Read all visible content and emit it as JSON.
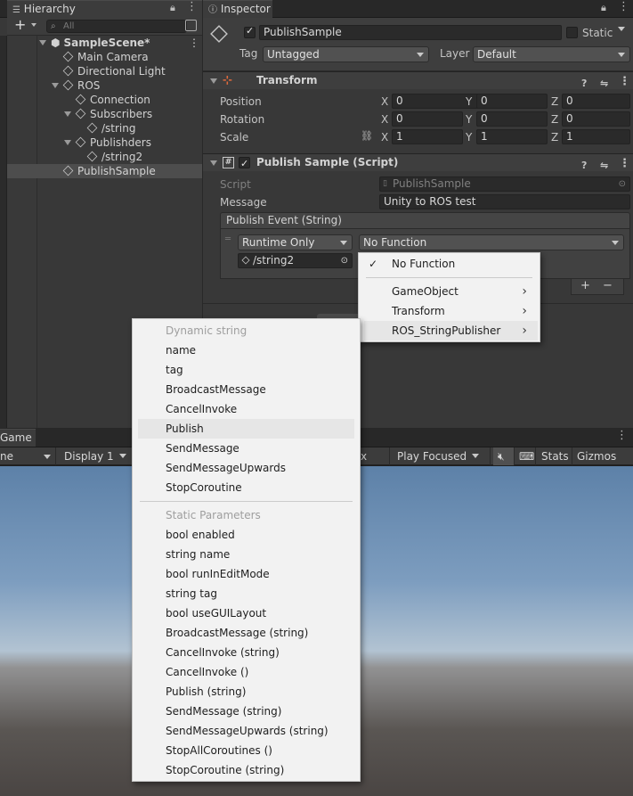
{
  "hierarchy": {
    "tab_label": "Hierarchy",
    "add_label": "+",
    "search_placeholder": "All",
    "items": [
      {
        "label": "SampleScene*",
        "depth": 0,
        "expanded": true,
        "scene": true
      },
      {
        "label": "Main Camera",
        "depth": 1
      },
      {
        "label": "Directional Light",
        "depth": 1
      },
      {
        "label": "ROS",
        "depth": 1,
        "expanded": true
      },
      {
        "label": "Connection",
        "depth": 2
      },
      {
        "label": "Subscribers",
        "depth": 2,
        "expanded": true
      },
      {
        "label": "/string",
        "depth": 3
      },
      {
        "label": "Publishders",
        "depth": 2,
        "expanded": true
      },
      {
        "label": "/string2",
        "depth": 3
      },
      {
        "label": "PublishSample",
        "depth": 1,
        "selected": true
      }
    ]
  },
  "inspector": {
    "tab_label": "Inspector",
    "object_name": "PublishSample",
    "static_label": "Static",
    "tag_label": "Tag",
    "tag_value": "Untagged",
    "layer_label": "Layer",
    "layer_value": "Default",
    "transform": {
      "title": "Transform",
      "position_label": "Position",
      "rotation_label": "Rotation",
      "scale_label": "Scale",
      "position": {
        "x": "0",
        "y": "0",
        "z": "0"
      },
      "rotation": {
        "x": "0",
        "y": "0",
        "z": "0"
      },
      "scale": {
        "x": "1",
        "y": "1",
        "z": "1"
      }
    },
    "script_component": {
      "title": "Publish Sample (Script)",
      "script_label": "Script",
      "script_value": "PublishSample",
      "message_label": "Message",
      "message_value": "Unity to ROS test",
      "event_title": "Publish Event (String)",
      "runtime_value": "Runtime Only",
      "function_value": "No Function",
      "target_value": "/string2",
      "add_label": "+",
      "remove_label": "−"
    }
  },
  "game": {
    "tab_label": "Game",
    "left_partial": "ne",
    "display_label": "Display 1",
    "x_partial": "x",
    "play_focused": "Play Focused",
    "stats_label": "Stats",
    "gizmos_label": "Gizmos"
  },
  "function_menu": {
    "items": [
      {
        "label": "No Function",
        "checked": true
      },
      {
        "label": "GameObject",
        "submenu": true
      },
      {
        "label": "Transform",
        "submenu": true
      },
      {
        "label": "ROS_StringPublisher",
        "submenu": true,
        "highlighted": true
      }
    ]
  },
  "method_menu": {
    "dynamic_header": "Dynamic string",
    "dynamic_items": [
      "name",
      "tag",
      "BroadcastMessage",
      "CancelInvoke",
      "Publish",
      "SendMessage",
      "SendMessageUpwards",
      "StopCoroutine"
    ],
    "highlighted_dynamic_index": 4,
    "static_header": "Static Parameters",
    "static_items": [
      "bool enabled",
      "string name",
      "bool runInEditMode",
      "string tag",
      "bool useGUILayout",
      "BroadcastMessage (string)",
      "CancelInvoke (string)",
      "CancelInvoke ()",
      "Publish (string)",
      "SendMessage (string)",
      "SendMessageUpwards (string)",
      "StopAllCoroutines ()",
      "StopCoroutine (string)"
    ]
  },
  "colors": {
    "panel": "#383838",
    "field": "#2a2a2a",
    "menu_bg": "#f2f2f2",
    "menu_highlight": "#e6e6e6"
  }
}
